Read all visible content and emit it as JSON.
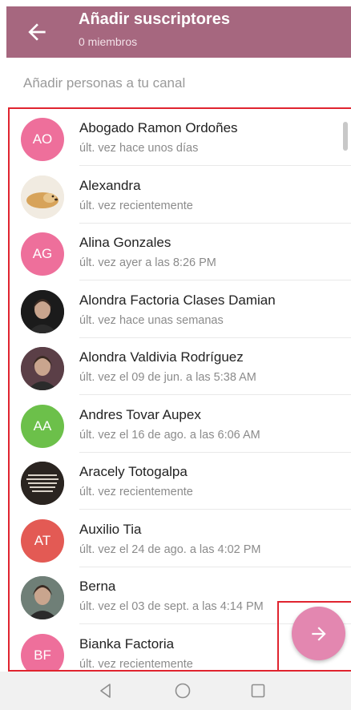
{
  "header": {
    "title": "Añadir suscriptores",
    "subtitle": "0 miembros",
    "background_color": "#a6677f"
  },
  "search": {
    "placeholder": "Añadir personas a tu canal",
    "value": ""
  },
  "contacts": [
    {
      "name": "Abogado Ramon Ordoñes",
      "status": "últ. vez hace unos días",
      "initials": "AO",
      "avatar_color": "#ee6f9b",
      "avatar_type": "initials"
    },
    {
      "name": "Alexandra",
      "status": "últ. vez recientemente",
      "initials": "",
      "avatar_color": "#efe6d8",
      "avatar_type": "photo",
      "photo_icon": "dog-photo-icon"
    },
    {
      "name": "Alina Gonzales",
      "status": "últ. vez ayer a las 8:26 PM",
      "initials": "AG",
      "avatar_color": "#ee6f9b",
      "avatar_type": "initials"
    },
    {
      "name": "Alondra Factoria Clases Damian",
      "status": "últ. vez hace unas semanas",
      "initials": "",
      "avatar_color": "#1b1b1b",
      "avatar_type": "photo",
      "photo_icon": "portrait-photo-icon"
    },
    {
      "name": "Alondra Valdivia Rodríguez",
      "status": "últ. vez el 09 de jun. a las 5:38 AM",
      "initials": "",
      "avatar_color": "#5b3f47",
      "avatar_type": "photo",
      "photo_icon": "portrait-photo-icon"
    },
    {
      "name": "Andres Tovar Aupex",
      "status": "últ. vez el 16 de ago. a las 6:06 AM",
      "initials": "AA",
      "avatar_color": "#6cc04a",
      "avatar_type": "initials"
    },
    {
      "name": "Aracely Totogalpa",
      "status": "últ. vez recientemente",
      "initials": "",
      "avatar_color": "#2a2420",
      "avatar_type": "photo",
      "photo_icon": "quote-photo-icon"
    },
    {
      "name": "Auxilio Tia",
      "status": "últ. vez el 24 de ago. a las 4:02 PM",
      "initials": "AT",
      "avatar_color": "#e35a54",
      "avatar_type": "initials"
    },
    {
      "name": "Berna",
      "status": "últ. vez el 03 de sept. a las 4:14 PM",
      "initials": "",
      "avatar_color": "#6f7f77",
      "avatar_type": "photo",
      "photo_icon": "portrait-photo-icon"
    },
    {
      "name": "Bianka Factoria",
      "status": "últ. vez recientemente",
      "initials": "BF",
      "avatar_color": "#ee6f9b",
      "avatar_type": "initials"
    }
  ],
  "fab": {
    "icon": "arrow-right-icon",
    "color": "#e387b0"
  },
  "highlight_color": "#e0242f",
  "navigation_bar": {
    "icons": [
      "back-triangle-icon",
      "home-circle-icon",
      "recents-square-icon"
    ]
  }
}
